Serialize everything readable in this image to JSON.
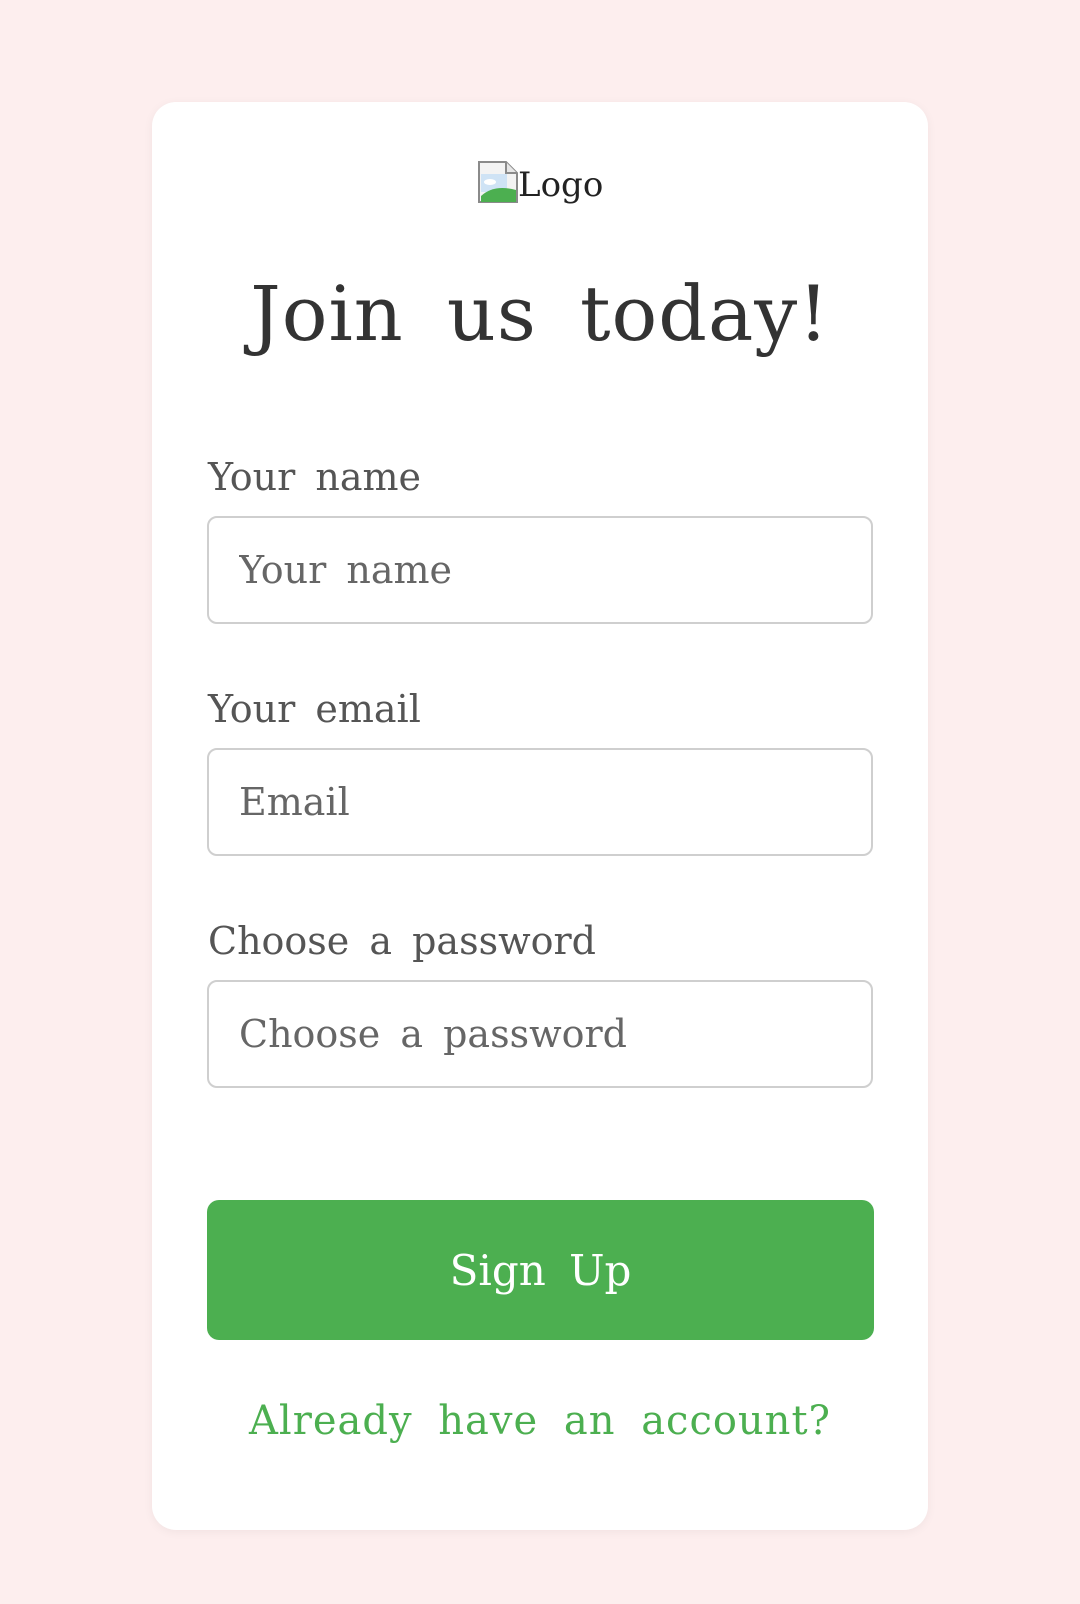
{
  "logo": {
    "alt_text": "Logo",
    "icon": "broken-image-icon"
  },
  "title": "Join us today!",
  "form": {
    "name_label": "Your name",
    "name_placeholder": "Your name",
    "email_label": "Your email",
    "email_placeholder": "Email",
    "password_label": "Choose a password",
    "password_placeholder": "Choose a password",
    "submit_label": "Sign Up"
  },
  "footer": {
    "login_link": "Already have an account?"
  },
  "colors": {
    "background": "#fdeeee",
    "card": "#ffffff",
    "accent": "#4caf50",
    "text": "#333333",
    "label": "#555555"
  }
}
